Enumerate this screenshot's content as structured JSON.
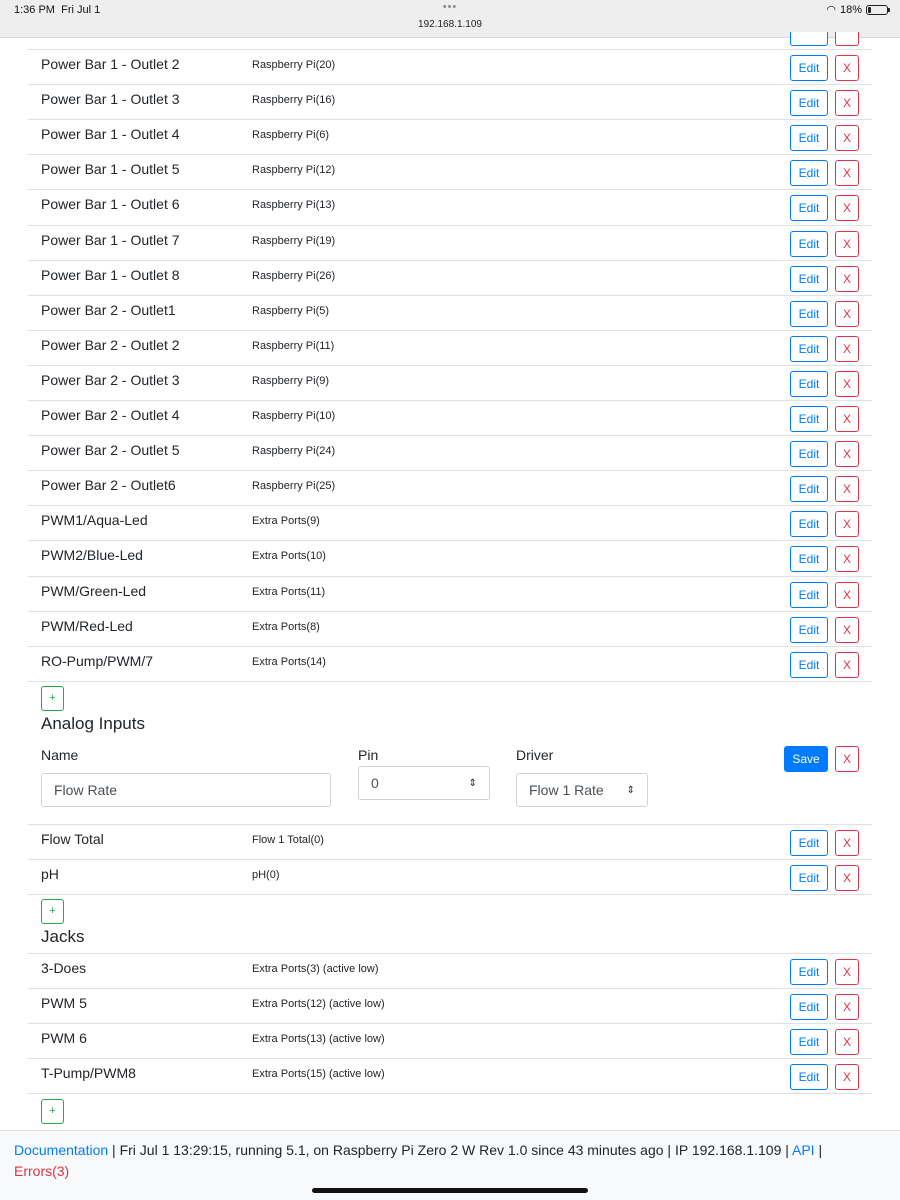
{
  "status_bar": {
    "time": "1:36 PM",
    "date": "Fri Jul 1",
    "dots": "•••",
    "url": "192.168.1.109",
    "battery": "18%",
    "battery_level": 0.18
  },
  "buttons": {
    "edit": "Edit",
    "delete": "X",
    "add": "+",
    "save": "Save"
  },
  "outlets": [
    {
      "name": "Power Bar 1 - Outlet 2",
      "pin": "Raspberry Pi(20)"
    },
    {
      "name": "Power Bar 1 - Outlet 3",
      "pin": "Raspberry Pi(16)"
    },
    {
      "name": "Power Bar 1 - Outlet 4",
      "pin": "Raspberry Pi(6)"
    },
    {
      "name": "Power Bar 1 - Outlet 5",
      "pin": "Raspberry Pi(12)"
    },
    {
      "name": "Power Bar 1 - Outlet 6",
      "pin": "Raspberry Pi(13)"
    },
    {
      "name": "Power Bar 1 - Outlet 7",
      "pin": "Raspberry Pi(19)"
    },
    {
      "name": "Power Bar 1 - Outlet 8",
      "pin": "Raspberry Pi(26)"
    },
    {
      "name": "Power Bar 2 - Outlet1",
      "pin": "Raspberry Pi(5)"
    },
    {
      "name": "Power Bar 2 - Outlet 2",
      "pin": "Raspberry Pi(11)"
    },
    {
      "name": "Power Bar 2 - Outlet 3",
      "pin": "Raspberry Pi(9)"
    },
    {
      "name": "Power Bar 2 - Outlet 4",
      "pin": "Raspberry Pi(10)"
    },
    {
      "name": "Power Bar 2 - Outlet 5",
      "pin": "Raspberry Pi(24)"
    },
    {
      "name": "Power Bar 2 - Outlet6",
      "pin": "Raspberry Pi(25)"
    },
    {
      "name": "PWM1/Aqua-Led",
      "pin": "Extra Ports(9)"
    },
    {
      "name": "PWM2/Blue-Led",
      "pin": "Extra Ports(10)"
    },
    {
      "name": "PWM/Green-Led",
      "pin": "Extra Ports(11)"
    },
    {
      "name": "PWM/Red-Led",
      "pin": "Extra Ports(8)"
    },
    {
      "name": "RO-Pump/PWM/7",
      "pin": "Extra Ports(14)"
    }
  ],
  "analog_inputs": {
    "title": "Analog Inputs",
    "form": {
      "name_label": "Name",
      "pin_label": "Pin",
      "driver_label": "Driver",
      "name_value": "Flow Rate",
      "pin_value": "0",
      "driver_value": "Flow 1 Rate"
    },
    "items": [
      {
        "name": "Flow Total",
        "pin": "Flow 1 Total(0)"
      },
      {
        "name": "pH",
        "pin": "pH(0)"
      }
    ]
  },
  "jacks": {
    "title": "Jacks",
    "items": [
      {
        "name": "3-Does",
        "pin": "Extra Ports(3) (active low)"
      },
      {
        "name": "PWM 5",
        "pin": "Extra Ports(12) (active low)"
      },
      {
        "name": "PWM 6",
        "pin": "Extra Ports(13) (active low)"
      },
      {
        "name": "T-Pump/PWM8",
        "pin": "Extra Ports(15) (active low)"
      }
    ]
  },
  "footer": {
    "documentation": "Documentation",
    "separator": " | ",
    "info": "Fri Jul 1 13:29:15,  running 5.1, on Raspberry Pi Zero 2 W Rev 1.0  since 43 minutes ago | IP 192.168.1.109 | ",
    "api": "API",
    "pipe": " |",
    "errors": "Errors(3)"
  }
}
